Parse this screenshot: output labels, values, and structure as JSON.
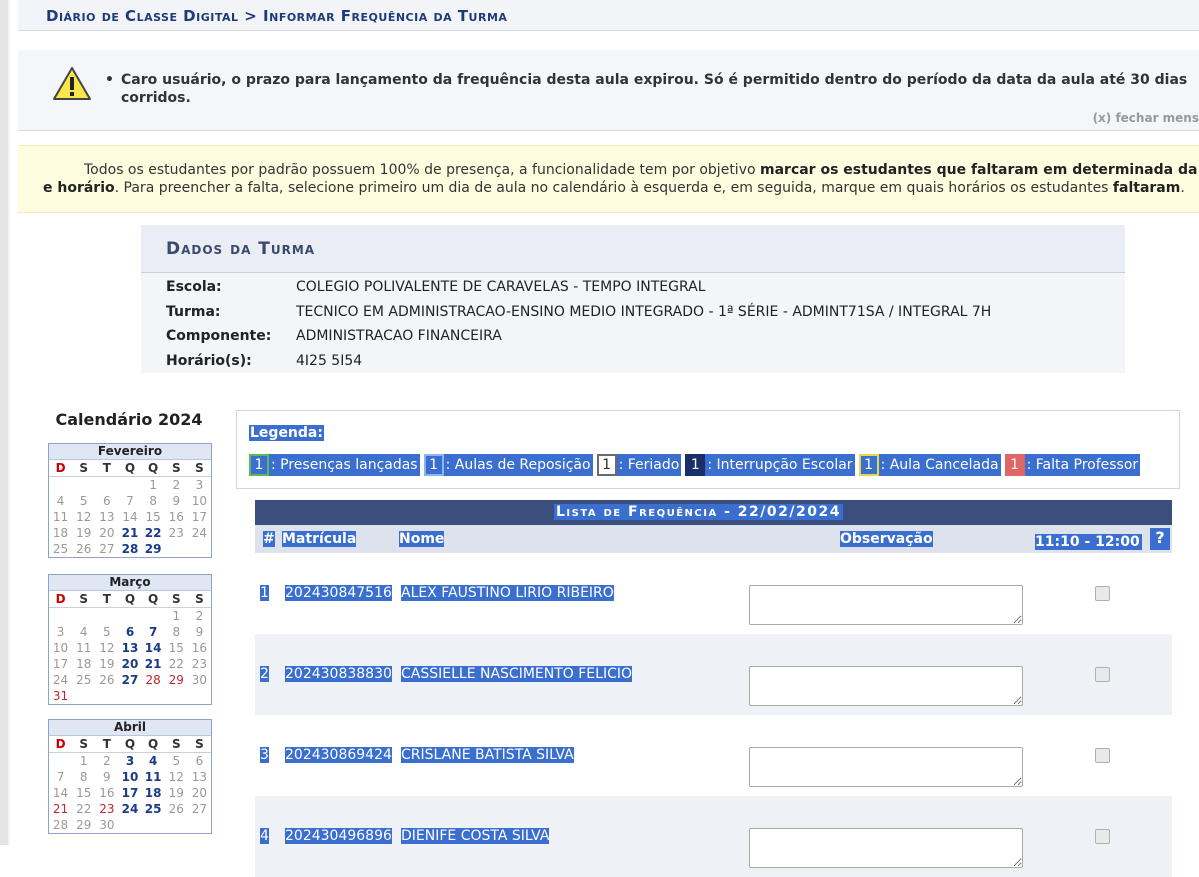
{
  "breadcrumb": "Diário de Classe Digital > Informar Frequência da Turma",
  "warning": {
    "message": "Caro usuário, o prazo para lançamento da frequência desta aula expirou. Só é permitido dentro do período da data da aula até 30 dias corridos.",
    "close": "(x) fechar mens"
  },
  "info": {
    "l1_a": "Todos os estudantes por padrão possuem 100% de presença, a funcionalidade tem por objetivo ",
    "l1_b": "marcar os estudantes que faltaram em determinada da",
    "l2_a": "e horário",
    "l2_b": ". Para preencher a falta, selecione primeiro um dia de aula no calendário à esquerda e, em seguida, marque em quais horários os estudantes ",
    "l2_c": "faltaram",
    "l2_d": "."
  },
  "dados": {
    "title": "Dados da Turma",
    "rows": [
      {
        "label": "Escola:",
        "value": "COLEGIO POLIVALENTE DE CARAVELAS - TEMPO INTEGRAL"
      },
      {
        "label": "Turma:",
        "value": "TECNICO EM ADMINISTRACAO-ENSINO MEDIO INTEGRADO - 1ª SÉRIE - ADMINT71SA / INTEGRAL 7H"
      },
      {
        "label": "Componente:",
        "value": "ADMINISTRACAO FINANCEIRA"
      },
      {
        "label": "Horário(s):",
        "value": "4I25 5I54"
      }
    ]
  },
  "calendar": {
    "title": "Calendário 2024",
    "dow": [
      "D",
      "S",
      "T",
      "Q",
      "Q",
      "S",
      "S"
    ],
    "months": [
      {
        "name": "Fevereiro",
        "weeks": [
          [
            "",
            "",
            "",
            "",
            "1",
            "2",
            "3"
          ],
          [
            "4",
            "5",
            "6",
            "7",
            "8",
            "9",
            "10"
          ],
          [
            "11",
            "12",
            "13",
            "14",
            "15",
            "16",
            "17"
          ],
          [
            "18",
            "19",
            "20",
            "21",
            "22",
            "23",
            "24"
          ],
          [
            "25",
            "26",
            "27",
            "28",
            "29",
            "",
            ""
          ]
        ],
        "class_days": [
          "21",
          "22",
          "28",
          "29"
        ],
        "red_days": []
      },
      {
        "name": "Março",
        "weeks": [
          [
            "",
            "",
            "",
            "",
            "",
            "1",
            "2"
          ],
          [
            "3",
            "4",
            "5",
            "6",
            "7",
            "8",
            "9"
          ],
          [
            "10",
            "11",
            "12",
            "13",
            "14",
            "15",
            "16"
          ],
          [
            "17",
            "18",
            "19",
            "20",
            "21",
            "22",
            "23"
          ],
          [
            "24",
            "25",
            "26",
            "27",
            "28",
            "29",
            "30"
          ],
          [
            "31",
            "",
            "",
            "",
            "",
            "",
            ""
          ]
        ],
        "class_days": [
          "6",
          "7",
          "13",
          "14",
          "20",
          "21",
          "27"
        ],
        "red_days": [
          "28",
          "29",
          "31"
        ]
      },
      {
        "name": "Abril",
        "weeks": [
          [
            "",
            "1",
            "2",
            "3",
            "4",
            "5",
            "6"
          ],
          [
            "7",
            "8",
            "9",
            "10",
            "11",
            "12",
            "13"
          ],
          [
            "14",
            "15",
            "16",
            "17",
            "18",
            "19",
            "20"
          ],
          [
            "21",
            "22",
            "23",
            "24",
            "25",
            "26",
            "27"
          ],
          [
            "28",
            "29",
            "30",
            "",
            "",
            "",
            ""
          ]
        ],
        "class_days": [
          "3",
          "4",
          "10",
          "11",
          "17",
          "18",
          "24",
          "25"
        ],
        "red_days": [
          "21",
          "23"
        ]
      }
    ]
  },
  "legend": {
    "title": "Legenda:",
    "items": [
      {
        "num": "1",
        "label": ": Presenças lançadas"
      },
      {
        "num": "1",
        "label": ": Aulas de Reposição"
      },
      {
        "num": "1",
        "label": ": Feriado"
      },
      {
        "num": "1",
        "label": ": Interrupção Escolar"
      },
      {
        "num": "1",
        "label": ": Aula Cancelada"
      },
      {
        "num": "1",
        "label": ": Falta Professor"
      }
    ]
  },
  "freq": {
    "title": "Lista de Frequência - 22/02/2024",
    "cols": {
      "num": "#",
      "mat": "Matrícula",
      "nome": "Nome",
      "obs": "Observação",
      "time": "11:10 - 12:00",
      "help": "?"
    },
    "students": [
      {
        "num": "1",
        "mat": "202430847516",
        "nome": "ALEX FAUSTINO LIRIO RIBEIRO"
      },
      {
        "num": "2",
        "mat": "202430838830",
        "nome": "CASSIELLE NASCIMENTO FELICIO"
      },
      {
        "num": "3",
        "mat": "202430869424",
        "nome": "CRISLANE BATISTA SILVA"
      },
      {
        "num": "4",
        "mat": "202430496896",
        "nome": "DIENIFE COSTA SILVA"
      }
    ]
  }
}
